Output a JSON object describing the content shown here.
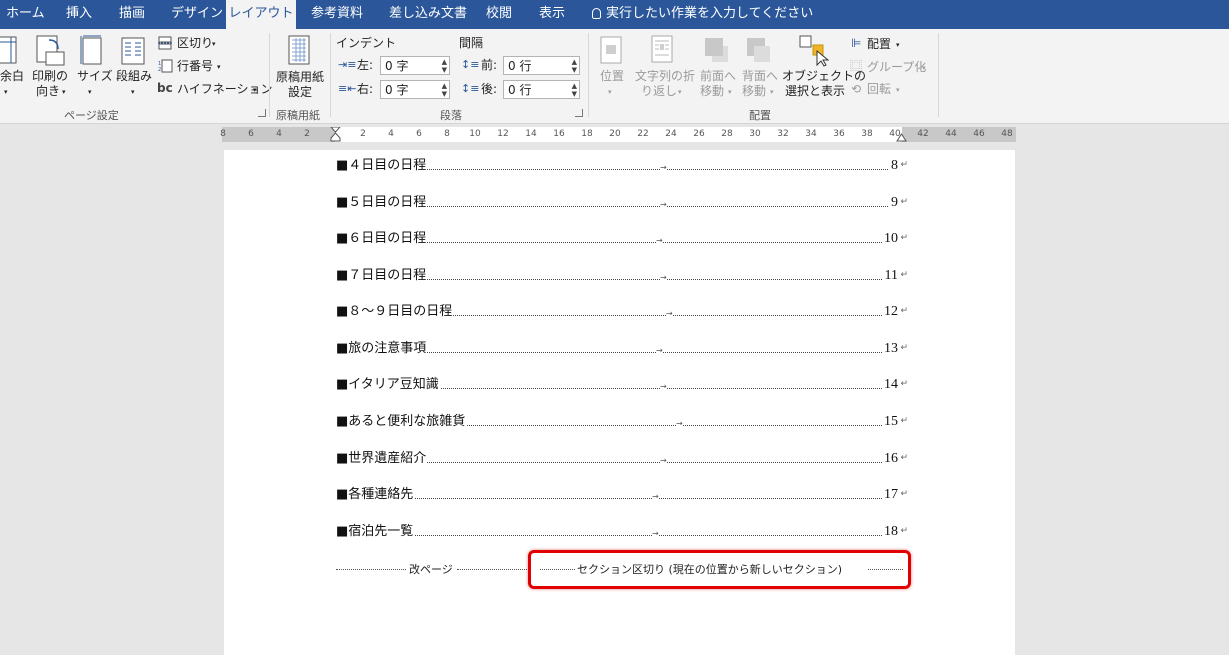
{
  "tabs": {
    "home": "ホーム",
    "insert": "挿入",
    "draw": "描画",
    "design": "デザイン",
    "layout": "レイアウト",
    "references": "参考資料",
    "mailings": "差し込み文書",
    "review": "校閲",
    "view": "表示",
    "tell_me": "実行したい作業を入力してください"
  },
  "ribbon": {
    "page_setup": {
      "margins": "余白",
      "orientation_1": "印刷の",
      "orientation_2": "向き",
      "size": "サイズ",
      "columns": "段組み",
      "breaks": "区切り",
      "line_numbers": "行番号",
      "hyphenation": "ハイフネーション",
      "group_label": "ページ設定"
    },
    "manuscript": {
      "button_1": "原稿用紙",
      "button_2": "設定",
      "group_label": "原稿用紙"
    },
    "paragraph": {
      "indent_header": "インデント",
      "spacing_header": "間隔",
      "left_label": "左:",
      "left_value": "0 字",
      "right_label": "右:",
      "right_value": "0 字",
      "before_label": "前:",
      "before_value": "0 行",
      "after_label": "後:",
      "after_value": "0 行",
      "group_label": "段落"
    },
    "arrange": {
      "position": "位置",
      "wrap_1": "文字列の折",
      "wrap_2": "り返し",
      "forward_1": "前面へ",
      "forward_2": "移動",
      "backward_1": "背面へ",
      "backward_2": "移動",
      "selection_1": "オブジェクトの",
      "selection_2": "選択と表示",
      "align": "配置",
      "group": "グループ化",
      "rotate": "回転",
      "group_label": "配置"
    }
  },
  "ruler": {
    "numbers": [
      "8",
      "6",
      "4",
      "2",
      "2",
      "4",
      "6",
      "8",
      "10",
      "12",
      "14",
      "16",
      "18",
      "20",
      "22",
      "24",
      "26",
      "28",
      "30",
      "32",
      "34",
      "36",
      "38",
      "40",
      "42",
      "44",
      "46",
      "48"
    ]
  },
  "toc": [
    {
      "title": "■４日目の日程",
      "page": "8"
    },
    {
      "title": "■５日目の日程",
      "page": "9"
    },
    {
      "title": "■６日目の日程",
      "page": "10"
    },
    {
      "title": "■７日目の日程",
      "page": "11"
    },
    {
      "title": "■８～９日目の日程",
      "page": "12"
    },
    {
      "title": "■旅の注意事項",
      "page": "13"
    },
    {
      "title": "■イタリア豆知識",
      "page": "14"
    },
    {
      "title": "■あると便利な旅雑貨",
      "page": "15"
    },
    {
      "title": "■世界遺産紹介",
      "page": "16"
    },
    {
      "title": "■各種連絡先",
      "page": "17"
    },
    {
      "title": "■宿泊先一覧",
      "page": "18"
    }
  ],
  "breaks": {
    "page_break": "改ページ",
    "section_break": "セクション区切り (現在の位置から新しいセクション)"
  },
  "colors": {
    "tab_bar": "#2b579a",
    "ribbon": "#f3f3f3",
    "highlight": "#e10000"
  }
}
